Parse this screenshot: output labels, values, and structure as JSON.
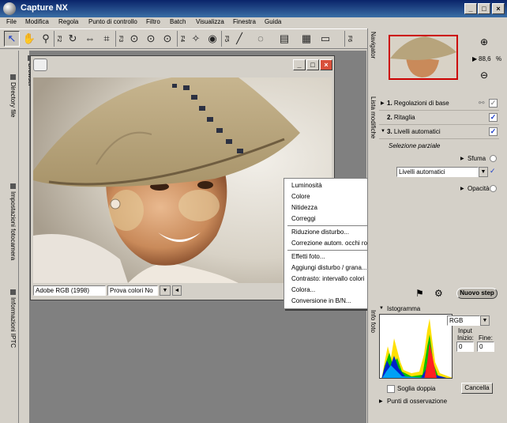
{
  "window": {
    "title": "Capture NX",
    "controls": [
      "_",
      "□",
      "×"
    ]
  },
  "menubar": [
    "File",
    "Modifica",
    "Regola",
    "Punto di controllo",
    "Filtro",
    "Batch",
    "Visualizza",
    "Finestra",
    "Guida"
  ],
  "toolbar": {
    "fkeys": [
      "F2",
      "F3",
      "F4",
      "F5",
      "F6"
    ]
  },
  "left_tabs": [
    "Directory file",
    "Impostazioni fotocamera",
    "Informazioni IPTC"
  ],
  "browser_tab": "Browser",
  "document": {
    "color_profile": "Adobe RGB (1998)",
    "proof_colors": "Prova colori No"
  },
  "context_menu": {
    "group1": [
      {
        "label": "Luminosità",
        "submenu": true
      },
      {
        "label": "Colore",
        "submenu": true
      },
      {
        "label": "Nitidezza",
        "submenu": true
      },
      {
        "label": "Correggi",
        "submenu": true
      }
    ],
    "group2": [
      {
        "label": "Riduzione disturbo..."
      },
      {
        "label": "Correzione autom. occhi rossi"
      }
    ],
    "group3": [
      {
        "label": "Effetti foto..."
      },
      {
        "label": "Aggiungi disturbo / grana..."
      },
      {
        "label": "Contrasto: intervallo colori"
      },
      {
        "label": "Colora..."
      },
      {
        "label": "Conversione in B/N..."
      }
    ]
  },
  "navigator": {
    "tab": "Navigator",
    "zoom": "88,6",
    "zoom_unit": "%"
  },
  "edit_list": {
    "tab": "Lista modifiche",
    "steps": [
      {
        "num": "1.",
        "label": "Regolazioni di base",
        "checked": true
      },
      {
        "num": "2.",
        "label": "Ritaglia",
        "checked": true
      },
      {
        "num": "3.",
        "label": "Livelli automatici",
        "checked": true
      }
    ],
    "partial_selection": "Selezione parziale",
    "blur_label": "Sfuma",
    "dropdown_value": "Livelli automatici",
    "opacity_label": "Opacità",
    "new_step_button": "Nuovo step"
  },
  "photo_info": {
    "tab": "Info foto",
    "histogram_label": "Istogramma",
    "channel": "RGB",
    "input_label": "Input",
    "start_label": "Inizio:",
    "end_label": "Fine:",
    "start_value": "0",
    "end_value": "0",
    "double_threshold": "Soglia doppia",
    "cancel_button": "Cancella"
  },
  "watch_points": "Punti di osservazione",
  "colors": {
    "title_start": "#0a246a",
    "title_end": "#3a6ea5",
    "accent": "#1a3bc8",
    "thumb_border": "#cc0000",
    "workspace": "#808080"
  }
}
